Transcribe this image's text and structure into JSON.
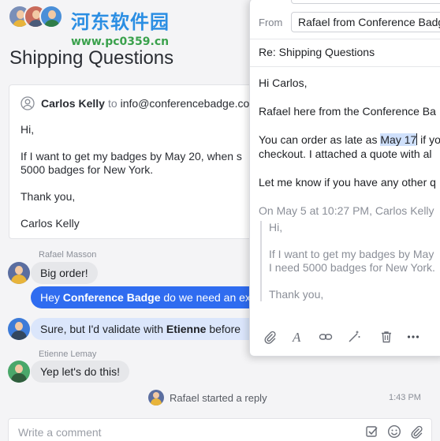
{
  "watermark": {
    "title": "河东软件园",
    "url": "www.pc0359.cn"
  },
  "conversation": {
    "title": "Shipping Questions",
    "email": {
      "sender": "Carlos Kelly",
      "to_word": "to",
      "to_address": "info@conferencebadge.co",
      "body": [
        "Hi,",
        "If I want to get my badges by May 20, when s",
        "5000 badges for New York.",
        "Thank you,",
        "Carlos Kelly"
      ]
    },
    "messages": [
      {
        "author": "Rafael Masson",
        "text": "Big order!"
      },
      {
        "text_prefix": "Hey ",
        "text_bold": "Conference Badge",
        "text_suffix": " do we need an ex"
      },
      {
        "text_prefix": "Sure, but I'd validate with ",
        "text_bold": "Etienne",
        "text_suffix": " before"
      },
      {
        "author": "Etienne Lemay",
        "text": "Yep let's do this!"
      }
    ],
    "reply_status": "Rafael started a reply",
    "timestamp": "1:43 PM",
    "composer_placeholder": "Write a comment"
  },
  "draft": {
    "from_label": "From",
    "from_value": "Rafael from Conference Badge",
    "subject": "Re: Shipping Questions",
    "body": {
      "greeting": "Hi Carlos,",
      "intro": "Rafael here from the Conference Ba",
      "line1_prefix": "You can order as late as ",
      "line1_highlight": "May 17",
      "line1_suffix": " if yo",
      "line2": "checkout. I attached a quote with al",
      "closing": "Let me know if you have any other q"
    },
    "quote_header": "On May 5 at 10:27 PM, Carlos Kelly",
    "quote": {
      "hi": "Hi,",
      "line1": "If I want to get my badges by May",
      "line2": "I need 5000 badges for New York.",
      "thanks": "Thank you,"
    }
  },
  "icons": {
    "person": "person-icon",
    "attach": "paperclip-icon",
    "format": "text-format-icon",
    "link": "link-icon",
    "snippet": "magic-wand-icon",
    "delete": "trash-icon",
    "more": "more-icon",
    "checkbox": "checkbox-icon",
    "emoji": "emoji-icon"
  },
  "colors": {
    "accent_blue": "#2f6cf0",
    "bubble_grey": "#e6e7ea",
    "bubble_light": "#dbe6fb",
    "highlight": "#cfe0fb"
  }
}
